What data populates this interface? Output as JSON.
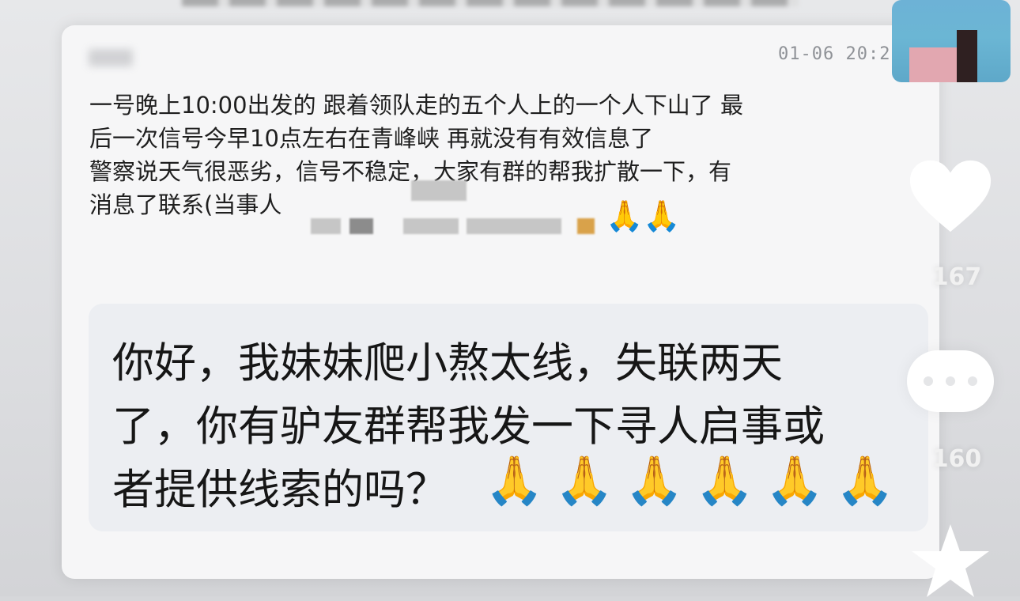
{
  "post": {
    "timestamp": "01-06 20:2",
    "lines": [
      "一号晚上10:00出发的 跟着领队走的五个人上的一个人下山了 最",
      "后一次信号今早10点左右在青峰峡 再就没有有效信息了",
      "警察说天气很恶劣，信号不稳定，大家有群的帮我扩散一下，有",
      "消息了联系(当事人"
    ],
    "pray_emojis": "🙏🙏"
  },
  "reply": {
    "lines": [
      "你好，我妹妹爬小熬太线，失联两天",
      "了，你有驴友群帮我发一下寻人启事或",
      "者提供线索的吗？"
    ],
    "pray_emojis": "🙏🙏🙏🙏🙏🙏"
  },
  "sidebar": {
    "like_count": "167",
    "comment_count": "160",
    "icons": [
      "heart-icon",
      "comment-icon",
      "star-icon"
    ]
  },
  "colors": {
    "card_bg": "#f6f6f7",
    "reply_bg": "#eceef2",
    "timestamp_color": "#8f9297",
    "avatar_blue": "#6db2d6"
  }
}
